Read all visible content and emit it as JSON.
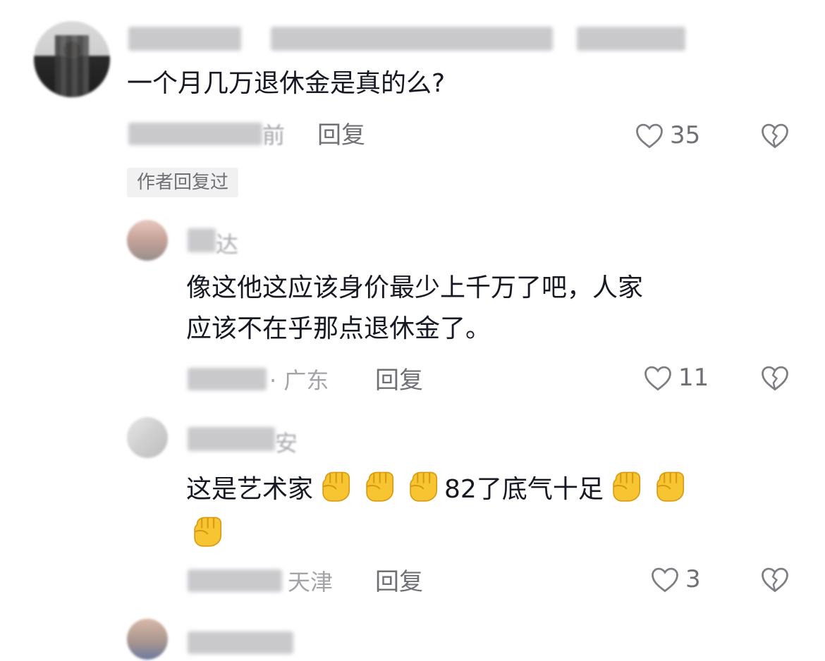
{
  "comments": [
    {
      "text": "一个月几万退休金是真的么?",
      "meta_suffix": "前",
      "reply_label": "回复",
      "likes": "35",
      "author_replied_tag": "作者回复过"
    }
  ],
  "replies": [
    {
      "username_tail": "达",
      "text_line1": "像这他这应该身价最少上千万了吧，人家",
      "text_line2": "应该不在乎那点退休金了。",
      "location": "· 广东",
      "reply_label": "回复",
      "likes": "11"
    },
    {
      "username_tail": "安",
      "text_part1": "这是艺术家",
      "text_part2": "82了底气十足",
      "location": "天津",
      "reply_label": "回复",
      "likes": "3"
    }
  ],
  "icons": {
    "like": "heart-outline-icon",
    "dislike": "broken-heart-icon",
    "emoji": "raised-fist-emoji"
  },
  "colors": {
    "text": "#161823",
    "meta": "#a3a4a8",
    "action": "#6f7075",
    "emoji_fill": "#f7c531"
  }
}
